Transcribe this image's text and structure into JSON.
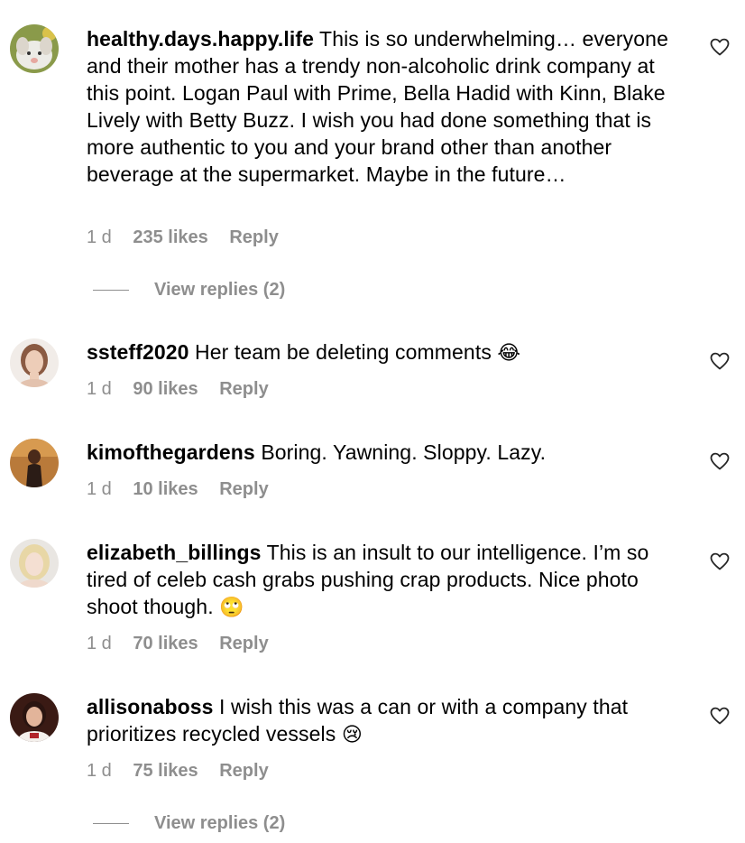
{
  "comments": [
    {
      "username": "healthy.days.happy.life",
      "text": "This is so underwhelming… everyone and their mother has a trendy non-alcoholic drink company at this point. Logan Paul with Prime, Bella Hadid with Kinn, Blake Lively with Betty Buzz. I wish you had done something that is more authentic to you and your brand other than another beverage at the supermarket. Maybe in the future…",
      "emoji": "",
      "time": "1 d",
      "likes": "235 likes",
      "reply": "Reply",
      "view_replies": "View replies (2)",
      "avatar": "dog-avatar"
    },
    {
      "username": "ssteff2020",
      "text": "Her team be deleting comments",
      "emoji": "😂",
      "time": "1 d",
      "likes": "90 likes",
      "reply": "Reply",
      "avatar": "woman-avatar"
    },
    {
      "username": "kimofthegardens",
      "text": "Boring. Yawning. Sloppy. Lazy.",
      "emoji": "",
      "time": "1 d",
      "likes": "10 likes",
      "reply": "Reply",
      "avatar": "woman-dark-avatar"
    },
    {
      "username": "elizabeth_billings",
      "text": "This is an insult to our intelligence. I’m so tired of celeb cash grabs pushing crap products. Nice photo shoot though.",
      "emoji": "🙄",
      "time": "1 d",
      "likes": "70 likes",
      "reply": "Reply",
      "avatar": "blonde-avatar"
    },
    {
      "username": "allisonaboss",
      "text": "I wish this was a can or with a company that prioritizes recycled vessels",
      "emoji": "😢",
      "time": "1 d",
      "likes": "75 likes",
      "reply": "Reply",
      "view_replies": "View replies (2)",
      "avatar": "person-dark-avatar"
    }
  ],
  "icons": {
    "like": "heart-icon"
  },
  "colors": {
    "text": "#000000",
    "muted": "#8e8e8e",
    "background": "#ffffff"
  }
}
